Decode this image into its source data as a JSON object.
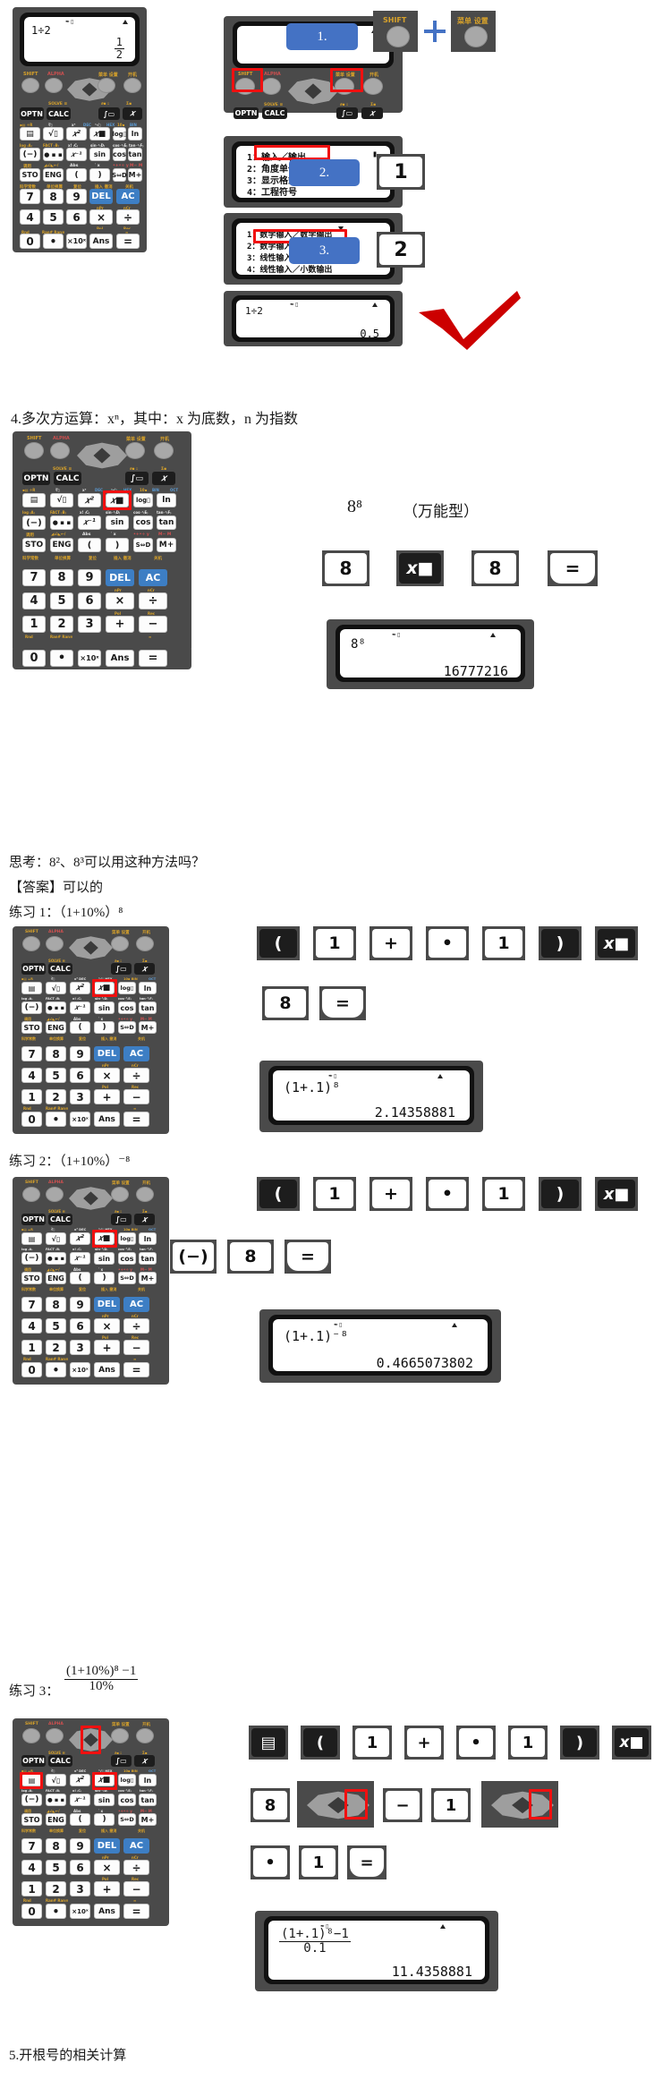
{
  "doc": {
    "headings": {
      "sec4": "4.多次方运算：xⁿ，其中：x 为底数，n 为指数",
      "think": "思考：8²、8³可以用这种方法吗？",
      "answer": "【答案】可以的",
      "ex1": "练习 1：（1+10%）⁸",
      "ex2": "练习 2：（1+10%）⁻⁸",
      "ex3_label": "练习 3：",
      "sec5": "5.开根号的相关计算"
    },
    "ex3_formula": {
      "numerator": "(1+10%)⁸ −1",
      "denominator": "10%"
    }
  },
  "section1": {
    "main_calc": {
      "lcd": {
        "expr": "1÷2",
        "status": "math",
        "result_num": "1",
        "result_den": "2"
      }
    },
    "steps": [
      {
        "index": "1.",
        "keys": [
          "SHIFT",
          "菜单 设置"
        ]
      },
      {
        "index": "2.",
        "keys": [
          "1"
        ]
      },
      {
        "index": "3.",
        "keys": [
          "2"
        ]
      }
    ],
    "panel_top_note": "SHIFT + 菜单/设置",
    "menu1": {
      "items": [
        "1：输入／输出",
        "2：角度单位",
        "3：显示格式",
        "4：工程符号"
      ],
      "highlight_index": 0
    },
    "menu2": {
      "items": [
        "1：数学输入／数学输出",
        "2：数学输入／小数输出",
        "3：线性输入／线性输出",
        "4：线性输入／小数输出"
      ],
      "highlight_index": 1
    },
    "final_lcd": {
      "expr": "1÷2",
      "result": "0.5"
    }
  },
  "section4": {
    "example_label": "8⁸",
    "example_note": "（万能型）",
    "keys": [
      "8",
      "x■",
      "8",
      "="
    ],
    "lcd": {
      "expr": "8⁸",
      "result": "16777216"
    }
  },
  "exercise1": {
    "keys_row1": [
      "(",
      "1",
      "+",
      "•",
      "1",
      ")",
      "x■"
    ],
    "keys_row2": [
      "8",
      "="
    ],
    "lcd": {
      "expr": "(1+.1)⁸",
      "result": "2.14358881"
    }
  },
  "exercise2": {
    "keys_row1": [
      "(",
      "1",
      "+",
      "•",
      "1",
      ")",
      "x■"
    ],
    "keys_row2": [
      "(−)",
      "8",
      "="
    ],
    "lcd": {
      "expr": "(1+.1)⁻⁸",
      "result": "0.4665073802"
    }
  },
  "exercise3": {
    "keys_row1": [
      "▤",
      "(",
      "1",
      "+",
      "•",
      "1",
      ")",
      "x■"
    ],
    "keys_row2": [
      "8",
      "▶",
      "−",
      "1",
      "▼"
    ],
    "keys_row3": [
      "•",
      "1",
      "="
    ],
    "lcd": {
      "expr_num": "(1+.1)⁸−1",
      "expr_den": "0.1",
      "result": "11.4358881"
    }
  },
  "keypad": {
    "top_labels": {
      "shift": "SHIFT",
      "alpha": "ALPHA",
      "menu": "菜单 设置",
      "power": "开机"
    },
    "fn_row0": [
      "OPTN",
      "CALC",
      "∫▭",
      "x"
    ],
    "fn_row0_above": [
      "",
      "SOLVE ≡",
      "d/dx■  :",
      "Σ■"
    ],
    "fn_row1": [
      "▤",
      "√▯",
      "x³",
      "x■",
      "log▯0",
      "ln"
    ],
    "fn_row1_above": [
      "▪▤ ÷R",
      "∛▯",
      "x³ DEC",
      "ⁿ√▯ HEX",
      "10■ BIN",
      "e■ OCT"
    ],
    "fn_row2": [
      "(−)",
      "•,··",
      "x⁻¹",
      "sin",
      "cos",
      "tan"
    ],
    "fn_row2_above": [
      "log ₍A₎",
      "FACT ₍B₎",
      "x! ₍C₎",
      "sin⁻¹ ₍D₎",
      "cos⁻¹ ₍E₎",
      "tan⁻¹ ₍F₎"
    ],
    "fn_row3": [
      "STO",
      "ENG",
      "(",
      ")",
      "S⇔D",
      "M+"
    ],
    "fn_row3_above": [
      "调用",
      "◢∠◣←/",
      "Abs",
      "′  x",
      "•+•÷ y",
      "M−  M"
    ],
    "num_row0_above": [
      "科学常数",
      "单位换算",
      "复位",
      "插入 撤消",
      "关机"
    ],
    "num_row0": [
      "7",
      "8",
      "9",
      "DEL",
      "AC"
    ],
    "num_row1_above": [
      "",
      "",
      "",
      "nPr",
      "nCr"
    ],
    "num_row1": [
      "4",
      "5",
      "6",
      "×",
      "÷"
    ],
    "num_row2_above": [
      "",
      "",
      "",
      "Pol",
      "Rec"
    ],
    "num_row2": [
      "1",
      "2",
      "3",
      "+",
      "−"
    ],
    "num_row3_above": [
      "Rnd",
      "Ran# Ran≡",
      "",
      "",
      "≈"
    ],
    "num_row3": [
      "0",
      "•",
      "×10ˣ",
      "Ans",
      "="
    ]
  },
  "colors": {
    "body": "#4a4a4a",
    "key_blue": "#3d7ec4",
    "accent_yellow": "#d8a22a",
    "accent_red": "#d05050",
    "callout_blue": "#4472c4",
    "highlight_red": "#f01010"
  }
}
